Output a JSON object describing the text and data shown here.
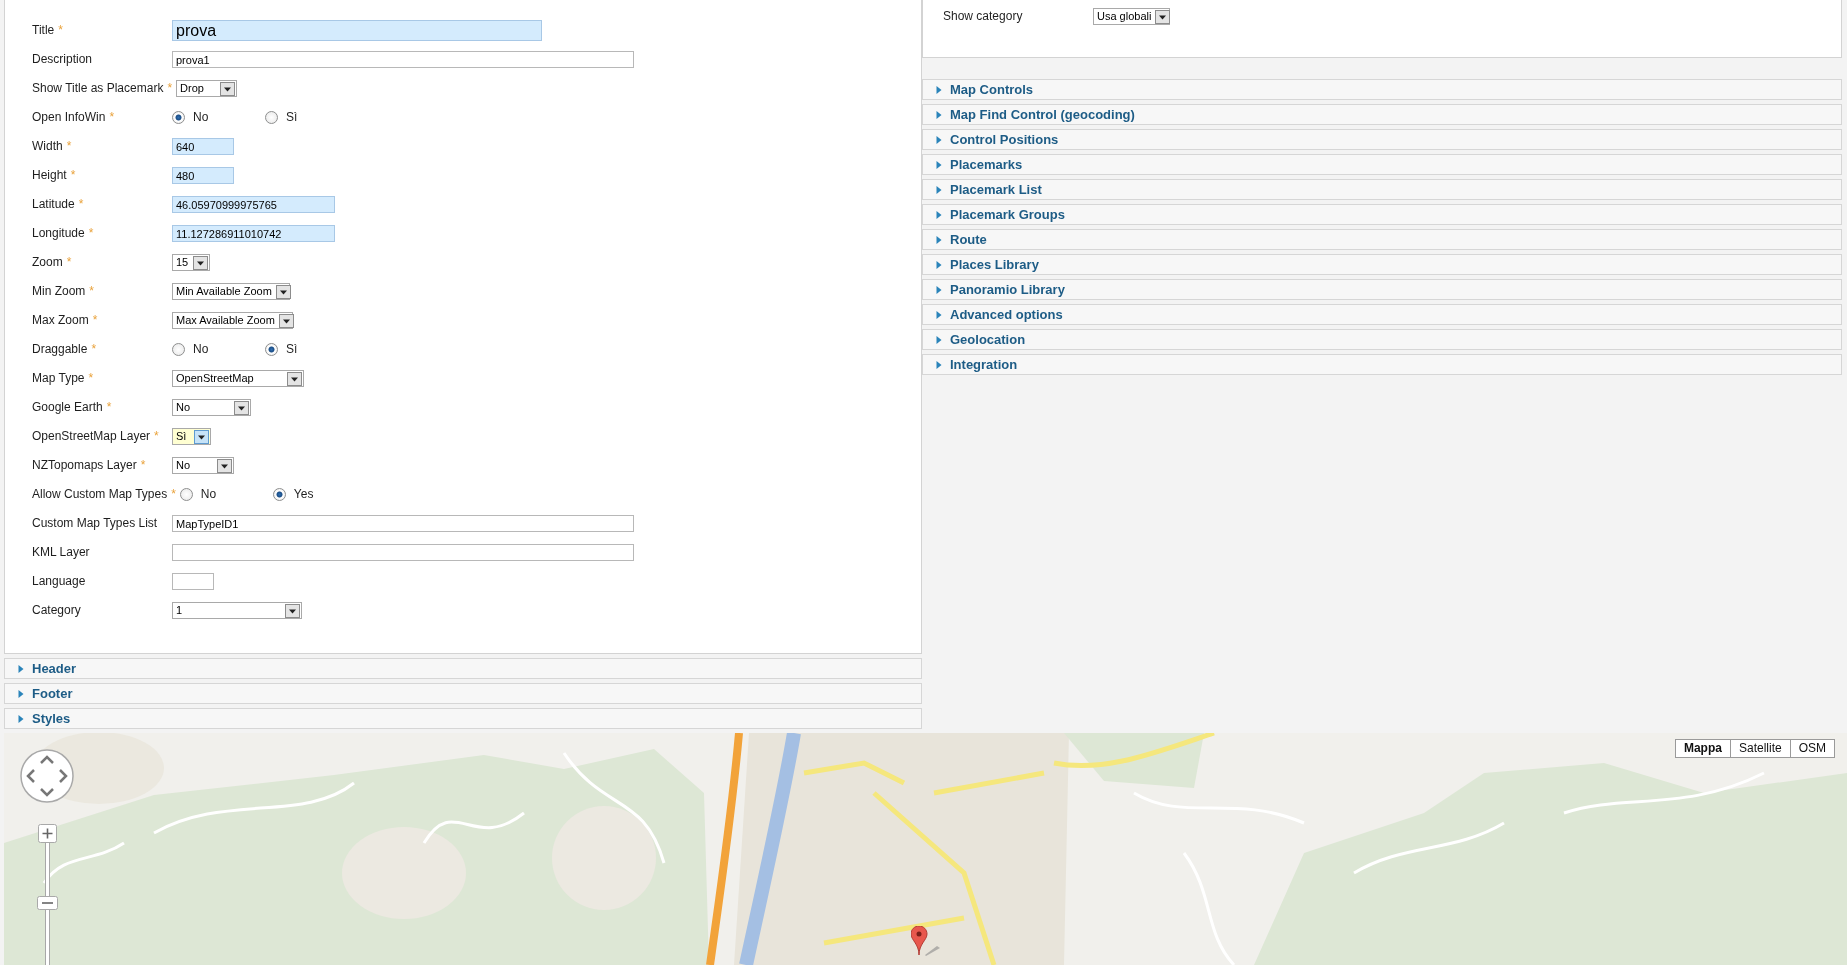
{
  "form": {
    "required_mark": "*",
    "fields": [
      {
        "kind": "text",
        "label": "Title",
        "required": true,
        "value": "prova"
      },
      {
        "kind": "text",
        "label": "Description",
        "required": false,
        "value": "prova1"
      },
      {
        "kind": "select",
        "label": "Show Title as Placemark",
        "required": true,
        "value": "Drop",
        "focused": false
      },
      {
        "kind": "radio",
        "label": "Open InfoWin",
        "required": true,
        "options": [
          {
            "label": "No",
            "selected": true
          },
          {
            "label": "Sì",
            "selected": false
          }
        ]
      },
      {
        "kind": "text",
        "label": "Width",
        "required": true,
        "value": "640"
      },
      {
        "kind": "text",
        "label": "Height",
        "required": true,
        "value": "480"
      },
      {
        "kind": "text",
        "label": "Latitude",
        "required": true,
        "value": "46.05970999975765"
      },
      {
        "kind": "text",
        "label": "Longitude",
        "required": true,
        "value": "11.127286911010742"
      },
      {
        "kind": "select",
        "label": "Zoom",
        "required": true,
        "value": "15",
        "focused": false
      },
      {
        "kind": "select",
        "label": "Min Zoom",
        "required": true,
        "value": "Min Available Zoom",
        "focused": false
      },
      {
        "kind": "select",
        "label": "Max Zoom",
        "required": true,
        "value": "Max Available Zoom",
        "focused": false
      },
      {
        "kind": "radio",
        "label": "Draggable",
        "required": true,
        "options": [
          {
            "label": "No",
            "selected": false
          },
          {
            "label": "Sì",
            "selected": true
          }
        ]
      },
      {
        "kind": "select",
        "label": "Map Type",
        "required": true,
        "value": "OpenStreetMap",
        "focused": false
      },
      {
        "kind": "select",
        "label": "Google Earth",
        "required": true,
        "value": "No",
        "focused": false
      },
      {
        "kind": "select",
        "label": "OpenStreetMap Layer",
        "required": true,
        "value": "Sì",
        "focused": true
      },
      {
        "kind": "select",
        "label": "NZTopomaps Layer",
        "required": true,
        "value": "No",
        "focused": false
      },
      {
        "kind": "radio",
        "label": "Allow Custom Map Types",
        "required": true,
        "options": [
          {
            "label": "No",
            "selected": false
          },
          {
            "label": "Yes",
            "selected": true
          }
        ]
      },
      {
        "kind": "text",
        "label": "Custom Map Types List",
        "required": false,
        "value": "MapTypeID1"
      },
      {
        "kind": "text",
        "label": "KML Layer",
        "required": false
      },
      {
        "kind": "text",
        "label": "Language",
        "required": false
      },
      {
        "kind": "select",
        "label": "Category",
        "required": false,
        "value": "1",
        "focused": false
      }
    ]
  },
  "left_sections": [
    {
      "title": "Header",
      "expanded": false
    },
    {
      "title": "Footer",
      "expanded": false
    },
    {
      "title": "Styles",
      "expanded": false
    }
  ],
  "show_category": {
    "label": "Show category",
    "value": "Usa globali",
    "focused": false
  },
  "right_sections": [
    {
      "title": "Map Controls",
      "expanded": false
    },
    {
      "title": "Map Find Control (geocoding)",
      "expanded": false
    },
    {
      "title": "Control Positions",
      "expanded": false
    },
    {
      "title": "Placemarks",
      "expanded": false
    },
    {
      "title": "Placemark List",
      "expanded": false
    },
    {
      "title": "Placemark Groups",
      "expanded": false
    },
    {
      "title": "Route",
      "expanded": false
    },
    {
      "title": "Places Library",
      "expanded": false
    },
    {
      "title": "Panoramio Library",
      "expanded": false
    },
    {
      "title": "Advanced options",
      "expanded": false
    },
    {
      "title": "Geolocation",
      "expanded": false
    },
    {
      "title": "Integration",
      "expanded": false
    }
  ],
  "map": {
    "map_types": [
      {
        "label": "Mappa",
        "selected": true
      },
      {
        "label": "Satellite",
        "selected": false
      },
      {
        "label": "OSM",
        "selected": false
      }
    ]
  }
}
